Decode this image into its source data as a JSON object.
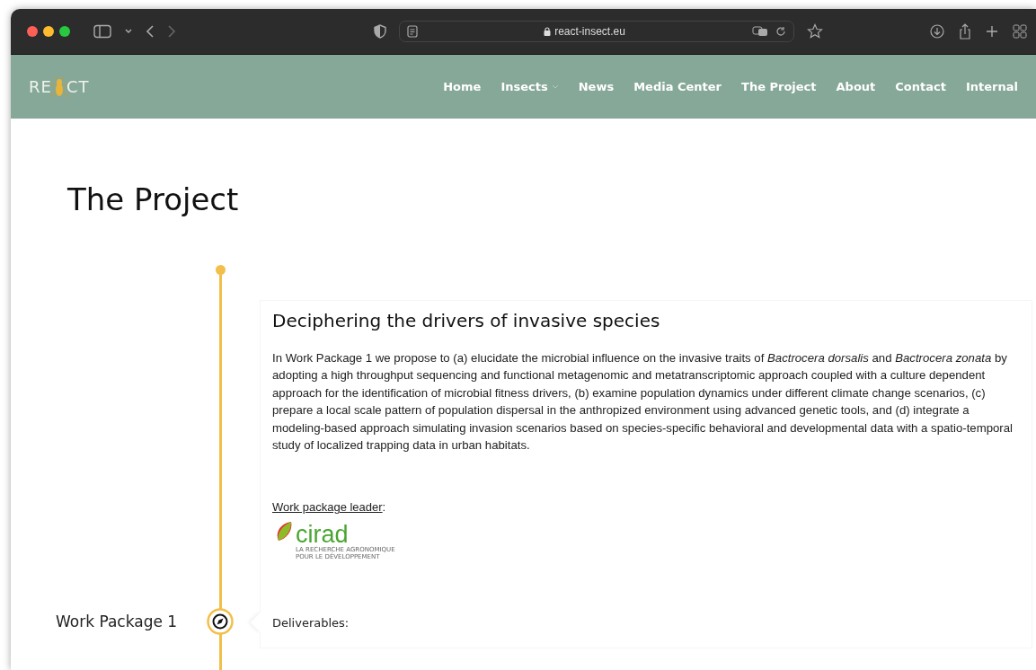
{
  "browser": {
    "url": "react-insect.eu"
  },
  "site": {
    "logo": [
      "RE",
      "CT"
    ],
    "nav": [
      {
        "label": "Home",
        "has_menu": false
      },
      {
        "label": "Insects",
        "has_menu": true
      },
      {
        "label": "News",
        "has_menu": false
      },
      {
        "label": "Media Center",
        "has_menu": false
      },
      {
        "label": "The Project",
        "has_menu": false
      },
      {
        "label": "About",
        "has_menu": false
      },
      {
        "label": "Contact",
        "has_menu": false
      },
      {
        "label": "Internal",
        "has_menu": false
      }
    ]
  },
  "page_title": "The Project",
  "timeline": [
    {
      "label": "Work Package 1",
      "title": "Deciphering the drivers of invasive species",
      "description": " In Work Package 1 we propose to (a) elucidate the microbial influence on the invasive traits of *Bactrocera dorsalis*  and *Bactrocera zonata* by adopting a high throughput sequencing and functional metagenomic and metatranscriptomic approach coupled with a culture dependent approach for the identification of microbial fitness drivers, (b) examine population dynamics under different climate change scenarios, (c) prepare a local scale pattern of population dispersal in the anthropized environment using advanced genetic tools, and (d) integrate a modeling-based approach simulating invasion scenarios based on species-specific behavioral and developmental data with a spatio-temporal study of localized trapping data in urban habitats.",
      "leader_label": "Work package leader",
      "leader_suffix": ":",
      "leader_logo": {
        "name": "cirad",
        "tagline": [
          "LA RECHERCHE AGRONOMIQUE",
          "POUR LE DÉVELOPPEMENT"
        ]
      },
      "deliverables_label": "Deliverables:"
    }
  ]
}
